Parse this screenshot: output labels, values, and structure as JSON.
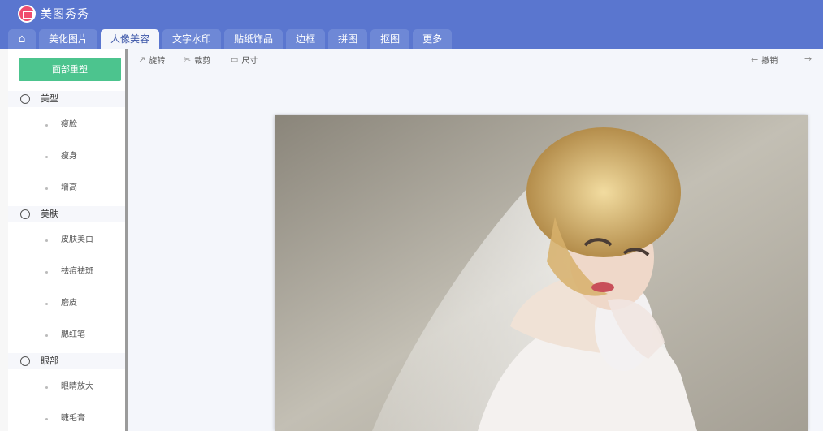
{
  "app": {
    "title": "美图秀秀"
  },
  "tabs": [
    {
      "label": "⌂"
    },
    {
      "label": "美化图片"
    },
    {
      "label": "人像美容"
    },
    {
      "label": "文字水印"
    },
    {
      "label": "贴纸饰品"
    },
    {
      "label": "边框"
    },
    {
      "label": "拼图"
    },
    {
      "label": "抠图"
    },
    {
      "label": "更多"
    }
  ],
  "sidebar": {
    "reset_button": "面部重塑",
    "sections": [
      {
        "label": "美型",
        "items": [
          "瘦脸",
          "瘦身",
          "增高"
        ]
      },
      {
        "label": "美肤",
        "items": [
          "皮肤美白",
          "祛痘祛斑",
          "磨皮",
          "腮红笔"
        ]
      },
      {
        "label": "眼部",
        "items": [
          "眼睛放大",
          "睫毛膏"
        ]
      }
    ]
  },
  "toolbar": {
    "rotate": "旋转",
    "crop": "裁剪",
    "size": "尺寸",
    "undo": "撤销"
  }
}
